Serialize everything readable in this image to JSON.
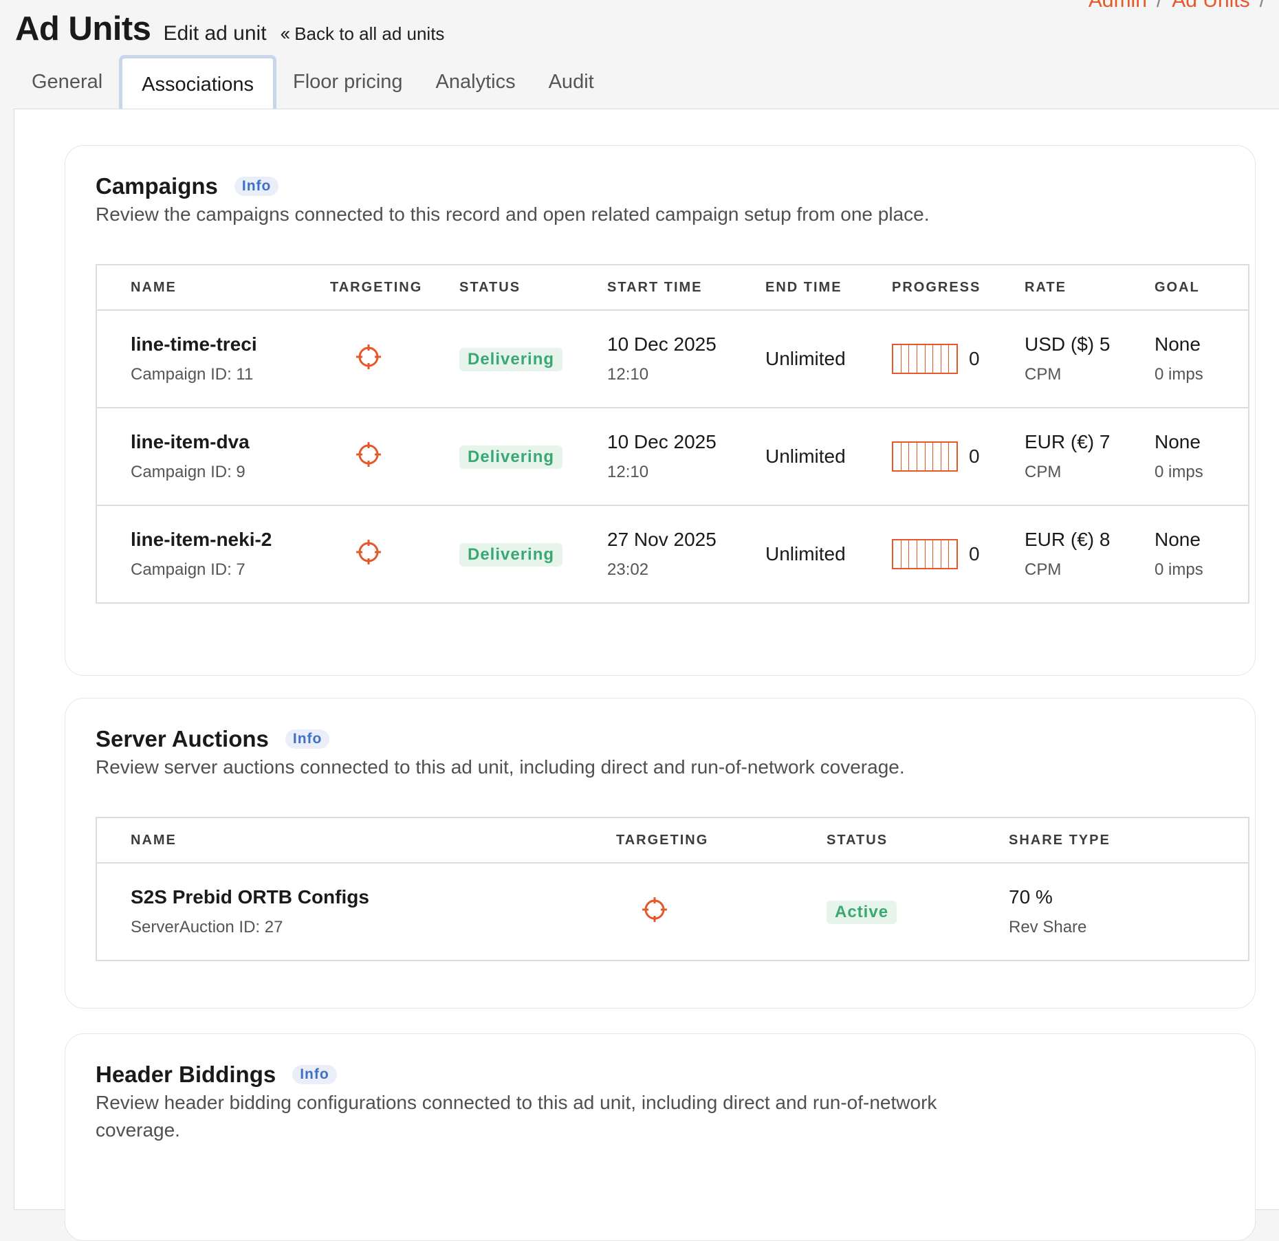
{
  "breadcrumb": [
    "Admin",
    "Ad Units"
  ],
  "header": {
    "title": "Ad Units",
    "subtitle": "Edit ad unit",
    "back_label": "Back to all ad units"
  },
  "tabs": [
    "General",
    "Associations",
    "Floor pricing",
    "Analytics",
    "Audit"
  ],
  "active_tab": "Associations",
  "colors": {
    "accent": "#e5582a",
    "status_green": "#3aa872",
    "info_blue": "#3e71c5",
    "tab_focus": "#c9d6ea"
  },
  "campaigns": {
    "title": "Campaigns",
    "info": "Info",
    "description": "Review the campaigns connected to this record and open related campaign setup from one place.",
    "columns": [
      "NAME",
      "TARGETING",
      "STATUS",
      "START TIME",
      "END TIME",
      "PROGRESS",
      "RATE",
      "GOAL"
    ],
    "rows": [
      {
        "name": "line-time-treci",
        "id_label": "Campaign ID: 11",
        "targeting_icon": "crosshair-icon",
        "status": "Delivering",
        "start_date": "10 Dec 2025",
        "start_time": "12:10",
        "end_time": "Unlimited",
        "progress": 0,
        "progress_label": "0",
        "rate": "USD ($) 5",
        "rate_unit": "CPM",
        "goal": "None",
        "goal_sub": "0 imps"
      },
      {
        "name": "line-item-dva",
        "id_label": "Campaign ID: 9",
        "targeting_icon": "crosshair-icon",
        "status": "Delivering",
        "start_date": "10 Dec 2025",
        "start_time": "12:10",
        "end_time": "Unlimited",
        "progress": 0,
        "progress_label": "0",
        "rate": "EUR (€) 7",
        "rate_unit": "CPM",
        "goal": "None",
        "goal_sub": "0 imps"
      },
      {
        "name": "line-item-neki-2",
        "id_label": "Campaign ID: 7",
        "targeting_icon": "crosshair-icon",
        "status": "Delivering",
        "start_date": "27 Nov 2025",
        "start_time": "23:02",
        "end_time": "Unlimited",
        "progress": 0,
        "progress_label": "0",
        "rate": "EUR (€) 8",
        "rate_unit": "CPM",
        "goal": "None",
        "goal_sub": "0 imps"
      }
    ]
  },
  "server_auctions": {
    "title": "Server Auctions",
    "info": "Info",
    "description": "Review server auctions connected to this ad unit, including direct and run-of-network coverage.",
    "columns": [
      "NAME",
      "TARGETING",
      "STATUS",
      "SHARE TYPE"
    ],
    "rows": [
      {
        "name": "S2S Prebid ORTB Configs",
        "id_label": "ServerAuction ID: 27",
        "targeting_icon": "crosshair-icon",
        "status": "Active",
        "share": "70 %",
        "share_type": "Rev Share"
      }
    ]
  },
  "header_biddings": {
    "title": "Header Biddings",
    "info": "Info",
    "description": "Review header bidding configurations connected to this ad unit, including direct and run-of-network coverage."
  }
}
